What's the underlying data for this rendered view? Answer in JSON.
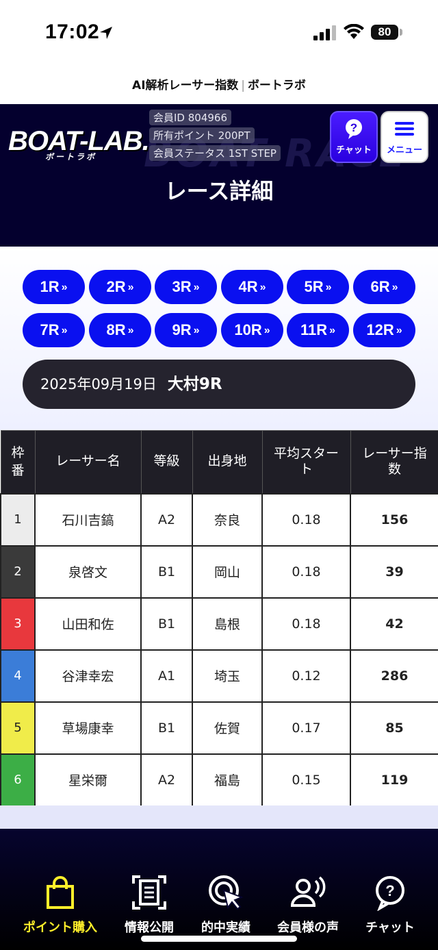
{
  "status": {
    "time": "17:02",
    "battery": "80"
  },
  "site_title": {
    "left": "AI解析レーサー指数",
    "right": "ボートラボ"
  },
  "header": {
    "logo": "BOAT-LAB.",
    "logo_sub": "ボートラボ",
    "member_id": "会員ID 804966",
    "points": "所有ポイント 200PT",
    "status": "会員ステータス 1ST STEP",
    "chat_label": "チャット",
    "menu_label": "メニュー",
    "page_heading": "レース詳細"
  },
  "races": [
    "1R",
    "2R",
    "3R",
    "4R",
    "5R",
    "6R",
    "7R",
    "8R",
    "9R",
    "10R",
    "11R",
    "12R"
  ],
  "race_info": {
    "date": "2025年09月19日",
    "race": "大村9R"
  },
  "table": {
    "headers": [
      "枠番",
      "レーサー名",
      "等級",
      "出身地",
      "平均スタート",
      "レーサー指数"
    ],
    "rows": [
      {
        "frame": "1",
        "name": "石川吉鎬",
        "grade": "A2",
        "origin": "奈良",
        "avg_start": "0.18",
        "score": "156"
      },
      {
        "frame": "2",
        "name": "泉啓文",
        "grade": "B1",
        "origin": "岡山",
        "avg_start": "0.18",
        "score": "39"
      },
      {
        "frame": "3",
        "name": "山田和佐",
        "grade": "B1",
        "origin": "島根",
        "avg_start": "0.18",
        "score": "42"
      },
      {
        "frame": "4",
        "name": "谷津幸宏",
        "grade": "A1",
        "origin": "埼玉",
        "avg_start": "0.12",
        "score": "286"
      },
      {
        "frame": "5",
        "name": "草場康幸",
        "grade": "B1",
        "origin": "佐賀",
        "avg_start": "0.17",
        "score": "85"
      },
      {
        "frame": "6",
        "name": "星栄爾",
        "grade": "A2",
        "origin": "福島",
        "avg_start": "0.15",
        "score": "119"
      }
    ]
  },
  "frame_colors": [
    "#ececec",
    "#3a3a3a",
    "#e8383d",
    "#3b7dd8",
    "#f0ec4a",
    "#3cae46"
  ],
  "frame_text_colors": [
    "#222",
    "#fff",
    "#fff",
    "#fff",
    "#222",
    "#fff"
  ],
  "nav": [
    {
      "label": "ポイント購入",
      "icon": "shopping-bag-icon",
      "active": true
    },
    {
      "label": "情報公開",
      "icon": "document-scan-icon",
      "active": false
    },
    {
      "label": "的中実績",
      "icon": "target-click-icon",
      "active": false
    },
    {
      "label": "会員様の声",
      "icon": "voice-user-icon",
      "active": false
    },
    {
      "label": "チャット",
      "icon": "chat-help-icon",
      "active": false
    }
  ],
  "colors": {
    "accent_blue": "#0a10f0",
    "header_bg": "#04002e",
    "active_nav": "#ffef2a"
  }
}
